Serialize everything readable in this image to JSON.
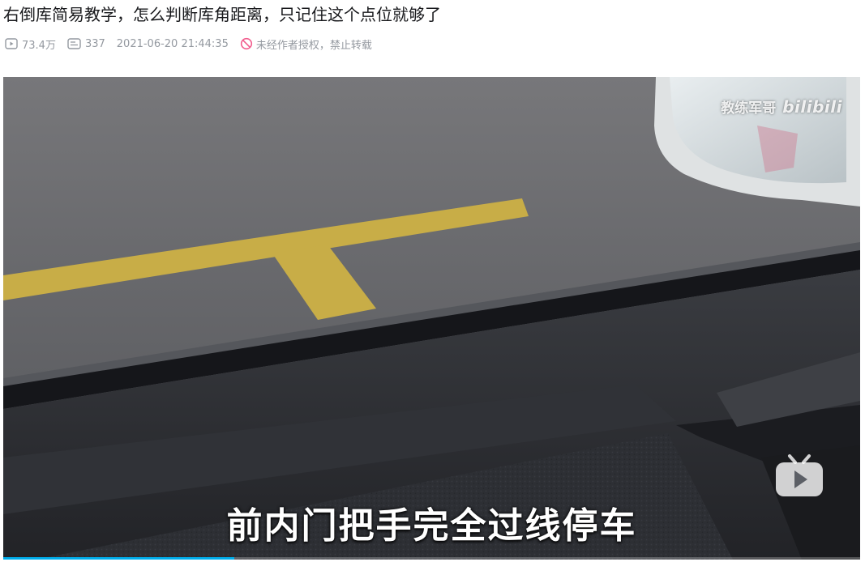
{
  "video": {
    "title": "右倒库简易教学，怎么判断库角距离，只记住这个点位就够了",
    "views": "73.4万",
    "danmaku": "337",
    "publish_time": "2021-06-20 21:44:35",
    "copyright": "未经作者授权，禁止转载"
  },
  "player": {
    "watermark_uploader": "教练军哥",
    "watermark_brand": "bilibili",
    "subtitle": "前内门把手完全过线停车",
    "progress": 0.27
  },
  "colors": {
    "accent": "#00aeec",
    "meta_text": "#9499a0",
    "title_text": "#18191c",
    "copyright_icon": "#f25d8e"
  },
  "icons": [
    "play-count-icon",
    "danmaku-icon",
    "no-reprint-icon",
    "bilibili-tv-icon"
  ]
}
